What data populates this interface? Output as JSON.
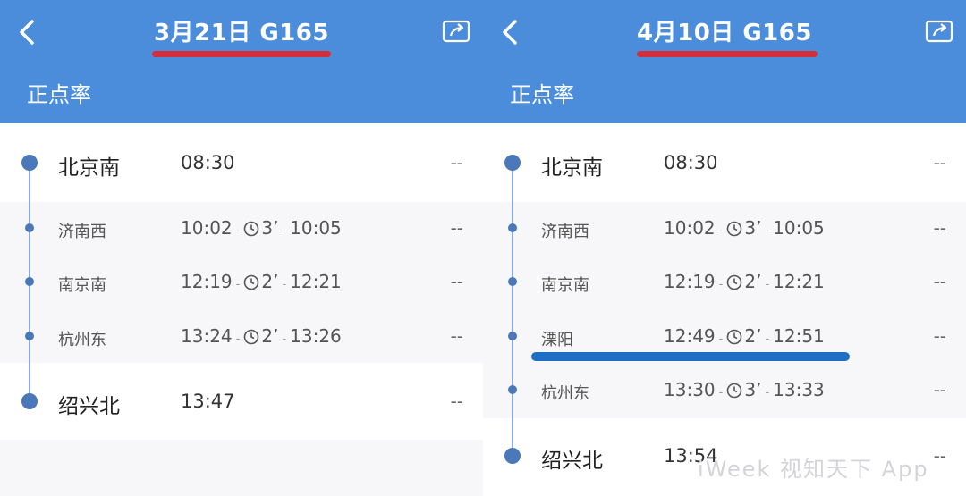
{
  "left": {
    "title": "3月21日 G165",
    "subtitle": "正点率",
    "stops": [
      {
        "name": "北京南",
        "arrive": "08:30",
        "dwell": "",
        "depart": "",
        "status": "--",
        "major": true
      },
      {
        "name": "济南西",
        "arrive": "10:02",
        "dwell": "3’",
        "depart": "10:05",
        "status": "--",
        "major": false
      },
      {
        "name": "南京南",
        "arrive": "12:19",
        "dwell": "2’",
        "depart": "12:21",
        "status": "--",
        "major": false
      },
      {
        "name": "杭州东",
        "arrive": "13:24",
        "dwell": "2’",
        "depart": "13:26",
        "status": "--",
        "major": false
      },
      {
        "name": "绍兴北",
        "arrive": "13:47",
        "dwell": "",
        "depart": "",
        "status": "--",
        "major": true
      }
    ]
  },
  "right": {
    "title": "4月10日 G165",
    "subtitle": "正点率",
    "stops": [
      {
        "name": "北京南",
        "arrive": "08:30",
        "dwell": "",
        "depart": "",
        "status": "--",
        "major": true
      },
      {
        "name": "济南西",
        "arrive": "10:02",
        "dwell": "3’",
        "depart": "10:05",
        "status": "--",
        "major": false
      },
      {
        "name": "南京南",
        "arrive": "12:19",
        "dwell": "2’",
        "depart": "12:21",
        "status": "--",
        "major": false
      },
      {
        "name": "溧阳",
        "arrive": "12:49",
        "dwell": "2’",
        "depart": "12:51",
        "status": "--",
        "major": false
      },
      {
        "name": "杭州东",
        "arrive": "13:30",
        "dwell": "3’",
        "depart": "13:33",
        "status": "--",
        "major": false
      },
      {
        "name": "绍兴北",
        "arrive": "13:54",
        "dwell": "",
        "depart": "",
        "status": "--",
        "major": true
      }
    ]
  },
  "separator": "-",
  "colors": {
    "header": "#4c8ddb",
    "red_mark": "#d62d3b",
    "blue_mark": "#1f6ec5"
  }
}
